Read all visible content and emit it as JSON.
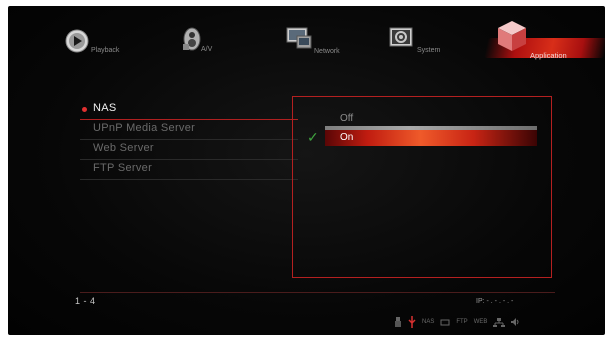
{
  "nav": {
    "tabs": [
      {
        "label": "Playback",
        "icon": "play-disc-icon"
      },
      {
        "label": "A/V",
        "icon": "av-speaker-icon"
      },
      {
        "label": "Network",
        "icon": "network-monitor-icon"
      },
      {
        "label": "System",
        "icon": "system-gear-icon"
      },
      {
        "label": "Application",
        "icon": "application-cube-icon",
        "active": true
      }
    ]
  },
  "menu": {
    "items": [
      {
        "label": "NAS",
        "selected": true
      },
      {
        "label": "UPnP Media Server"
      },
      {
        "label": "Web Server"
      },
      {
        "label": "FTP Server"
      }
    ]
  },
  "options": {
    "items": [
      {
        "label": "Off",
        "checked": false
      },
      {
        "label": "On",
        "checked": true,
        "highlighted": true
      }
    ]
  },
  "footer": {
    "page_indicator": "1 - 4",
    "ip": "IP: - . - . - . -",
    "status_labels": {
      "nas": "NAS",
      "ftp": "FTP",
      "web": "WEB"
    }
  },
  "colors": {
    "accent": "#d42a16",
    "panel_border": "#b42020",
    "check": "#3fa23f",
    "background": "#050505"
  }
}
